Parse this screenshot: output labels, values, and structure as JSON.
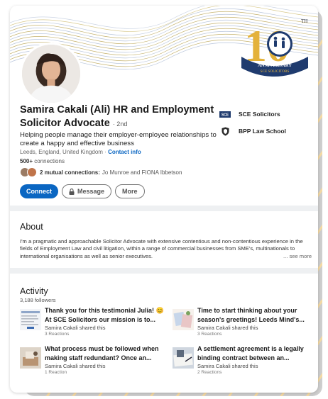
{
  "profile": {
    "name": "Samira Cakali (Ali) HR and Employment Solicitor Advocate",
    "degree": "· 2nd",
    "headline": "Helping people manage their employer-employee relationships to create a happy and effective business",
    "location": "Leeds, England, United Kingdom",
    "location_sep": " · ",
    "contact_info": "Contact info",
    "connections_count": "500+",
    "connections_label": " connections",
    "mutual_count": "2 mutual connections:",
    "mutual_names": "Jo Munroe and FIONA Ibbetson"
  },
  "badge": {
    "number": "10",
    "superscript": "TH",
    "ribbon_line1": "ANNIVERSARY",
    "ribbon_line2": "SCE SOLICITORS"
  },
  "actions": {
    "connect": "Connect",
    "message": "Message",
    "more": "More"
  },
  "companies": [
    {
      "name": "SCE Solicitors",
      "logo_text": "SCE"
    },
    {
      "name": "BPP Law School"
    }
  ],
  "about": {
    "title": "About",
    "text": "I'm a pragmatic and approachable Solicitor Advocate with extensive contentious and non-contentious experience in the fields of Employment Law and civil litigation, within a range of commercial businesses from SME's, multinationals to international organisations as well as senior executives.",
    "see_more": "... see more"
  },
  "activity": {
    "title": "Activity",
    "followers": "3,188 followers",
    "posts": [
      {
        "title": "Thank you for this testimonial Julia! 😊 At SCE Solicitors our mission is to...",
        "meta": "Samira Cakali shared this",
        "reactions": "3 Reactions"
      },
      {
        "title": "Time to start thinking about your season's greetings! Leeds Mind's...",
        "meta": "Samira Cakali shared this",
        "reactions": "3 Reactions"
      },
      {
        "title": "What process must be followed when making staff redundant? Once an...",
        "meta": "Samira Cakali shared this",
        "reactions": "1 Reaction"
      },
      {
        "title": "A settlement agreement is a legally binding contract between an...",
        "meta": "Samira Cakali shared this",
        "reactions": "2 Reactions"
      }
    ]
  },
  "colors": {
    "linkedin_blue": "#0a66c2",
    "badge_gold": "#e4b23a",
    "badge_navy": "#1f3b6e"
  }
}
